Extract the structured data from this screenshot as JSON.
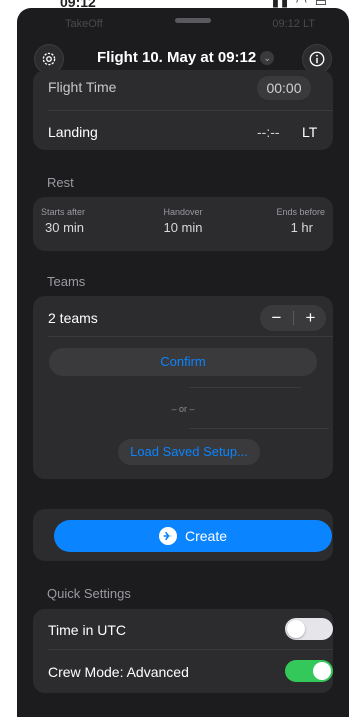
{
  "header": {
    "title": "Flight 10. May at 09:12"
  },
  "flight_card": {
    "flight_time_label": "Flight Time",
    "flight_time_value": "00:00",
    "landing_label": "Landing",
    "landing_value": "--:--",
    "landing_tz": "LT"
  },
  "rest": {
    "section_title": "Rest",
    "starts_after_label": "Starts after",
    "starts_after_value": "30 min",
    "handover_label": "Handover",
    "handover_value": "10 min",
    "ends_before_label": "Ends before",
    "ends_before_value": "1 hr"
  },
  "teams": {
    "section_title": "Teams",
    "count_label": "2 teams",
    "minus": "−",
    "plus": "+",
    "confirm_label": "Confirm",
    "or_text": "– or –",
    "load_label": "Load Saved Setup..."
  },
  "create": {
    "label": "Create"
  },
  "quick_settings": {
    "section_title": "Quick Settings",
    "items": [
      {
        "label": "Time in UTC",
        "on": false
      },
      {
        "label": "Crew Mode: Advanced",
        "on": true
      }
    ]
  },
  "colors": {
    "accent": "#0a84ff",
    "toggle_on": "#34c759",
    "toggle_off": "#e5e5ea"
  },
  "icons": {
    "settings": "gear-icon",
    "info": "info-icon",
    "create": "airplane-icon",
    "title_chevron": "chevron-down-icon"
  }
}
